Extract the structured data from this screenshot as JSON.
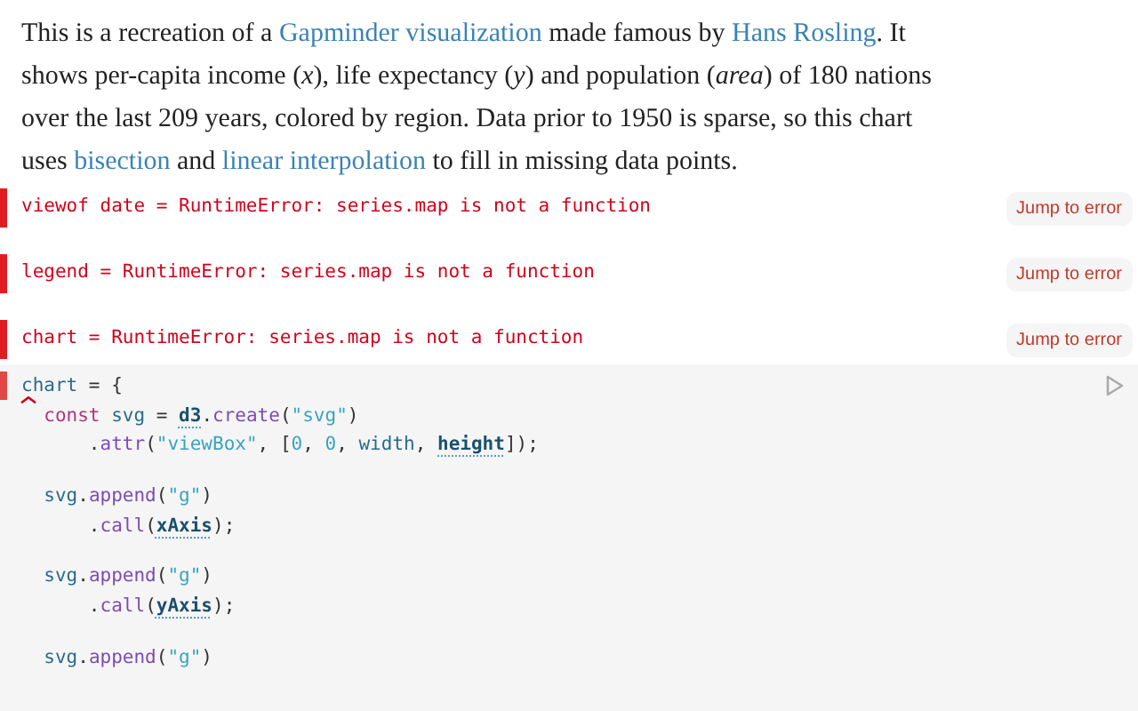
{
  "intro": [
    {
      "kind": "text",
      "text": "This is a recreation of a "
    },
    {
      "kind": "link",
      "text": "Gapminder visualization"
    },
    {
      "kind": "text",
      "text": " made famous by "
    },
    {
      "kind": "link",
      "text": "Hans Rosling"
    },
    {
      "kind": "text",
      "text": ". It shows per-capita income (*x*), life expectancy (*y*) and population (*area*) of 180 nations over the last 209 years, colored by region. Data prior to 1950 is sparse, so this chart uses "
    },
    {
      "kind": "link",
      "text": "bisection"
    },
    {
      "kind": "text",
      "text": " and "
    },
    {
      "kind": "link",
      "text": "linear interpolation"
    },
    {
      "kind": "text",
      "text": " to fill in missing data points."
    }
  ],
  "errors": [
    {
      "message": "viewof date = RuntimeError: series.map is not a function",
      "button": "Jump to error"
    },
    {
      "message": "legend = RuntimeError: series.map is not a function",
      "button": "Jump to error"
    },
    {
      "message": "chart = RuntimeError: series.map is not a function",
      "button": "Jump to error"
    }
  ],
  "code": {
    "error": true,
    "blocks": [
      {
        "lines": [
          [
            {
              "kind": "var",
              "text": "chart"
            },
            {
              "kind": "punct",
              "text": " = {"
            }
          ],
          [
            {
              "kind": "keyword",
              "text": "  const"
            },
            {
              "kind": "var",
              "text": " svg"
            },
            {
              "kind": "punct",
              "text": " = "
            },
            {
              "kind": "ref",
              "text": "d3"
            },
            {
              "kind": "punct",
              "text": "."
            },
            {
              "kind": "method",
              "text": "create"
            },
            {
              "kind": "punct",
              "text": "("
            },
            {
              "kind": "string",
              "text": "\"svg\""
            },
            {
              "kind": "punct",
              "text": ")"
            }
          ],
          [
            {
              "kind": "punct",
              "text": "      ."
            },
            {
              "kind": "method",
              "text": "attr"
            },
            {
              "kind": "punct",
              "text": "("
            },
            {
              "kind": "string",
              "text": "\"viewBox\""
            },
            {
              "kind": "punct",
              "text": ", ["
            },
            {
              "kind": "number",
              "text": "0"
            },
            {
              "kind": "punct",
              "text": ", "
            },
            {
              "kind": "number",
              "text": "0"
            },
            {
              "kind": "punct",
              "text": ", "
            },
            {
              "kind": "var",
              "text": "width"
            },
            {
              "kind": "punct",
              "text": ", "
            },
            {
              "kind": "ref",
              "text": "height"
            },
            {
              "kind": "punct",
              "text": "]);"
            }
          ]
        ]
      },
      {
        "lines": [
          [
            {
              "kind": "var",
              "text": "  svg"
            },
            {
              "kind": "punct",
              "text": "."
            },
            {
              "kind": "method",
              "text": "append"
            },
            {
              "kind": "punct",
              "text": "("
            },
            {
              "kind": "string",
              "text": "\"g\""
            },
            {
              "kind": "punct",
              "text": ")"
            }
          ],
          [
            {
              "kind": "punct",
              "text": "      ."
            },
            {
              "kind": "method",
              "text": "call"
            },
            {
              "kind": "punct",
              "text": "("
            },
            {
              "kind": "ref",
              "text": "xAxis"
            },
            {
              "kind": "punct",
              "text": ");"
            }
          ]
        ]
      },
      {
        "lines": [
          [
            {
              "kind": "var",
              "text": "  svg"
            },
            {
              "kind": "punct",
              "text": "."
            },
            {
              "kind": "method",
              "text": "append"
            },
            {
              "kind": "punct",
              "text": "("
            },
            {
              "kind": "string",
              "text": "\"g\""
            },
            {
              "kind": "punct",
              "text": ")"
            }
          ],
          [
            {
              "kind": "punct",
              "text": "      ."
            },
            {
              "kind": "method",
              "text": "call"
            },
            {
              "kind": "punct",
              "text": "("
            },
            {
              "kind": "ref",
              "text": "yAxis"
            },
            {
              "kind": "punct",
              "text": ");"
            }
          ]
        ]
      },
      {
        "lines": [
          [
            {
              "kind": "var",
              "text": "  svg"
            },
            {
              "kind": "punct",
              "text": "."
            },
            {
              "kind": "method",
              "text": "append"
            },
            {
              "kind": "punct",
              "text": "("
            },
            {
              "kind": "string",
              "text": "\"g\""
            },
            {
              "kind": "punct",
              "text": ")"
            }
          ]
        ]
      }
    ]
  }
}
